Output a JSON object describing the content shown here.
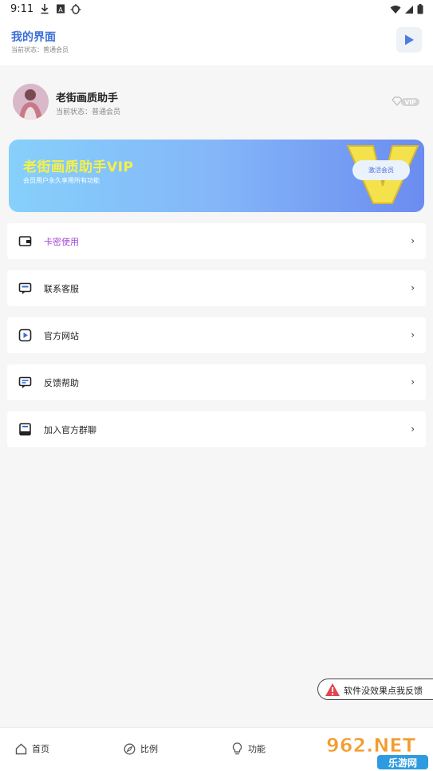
{
  "status_bar": {
    "time": "9:11"
  },
  "header": {
    "title": "我的界面",
    "subtitle": "当前状态：普通会员"
  },
  "profile": {
    "name": "老街画质助手",
    "status": "当前状态：普通会员",
    "badge": "VIP"
  },
  "banner": {
    "title": "老街画质助手VIP",
    "subtitle": "会员用户永久享用所有功能",
    "button": "激活会员"
  },
  "menu": [
    {
      "label": "卡密使用",
      "icon": "card-icon"
    },
    {
      "label": "联系客服",
      "icon": "chat-icon"
    },
    {
      "label": "官方网站",
      "icon": "play-box-icon"
    },
    {
      "label": "反馈帮助",
      "icon": "message-icon"
    },
    {
      "label": "加入官方群聊",
      "icon": "book-icon"
    }
  ],
  "feedback": {
    "label": "软件没效果点我反馈"
  },
  "nav": [
    {
      "label": "首页",
      "icon": "home-icon"
    },
    {
      "label": "比例",
      "icon": "compass-icon"
    },
    {
      "label": "功能",
      "icon": "bulb-icon"
    }
  ],
  "watermark": {
    "text": "962.NET",
    "sub": "乐游网"
  },
  "colors": {
    "accent": "#3a6fd8",
    "banner_title": "#f6f04a",
    "card_label": "#a24ad8"
  }
}
